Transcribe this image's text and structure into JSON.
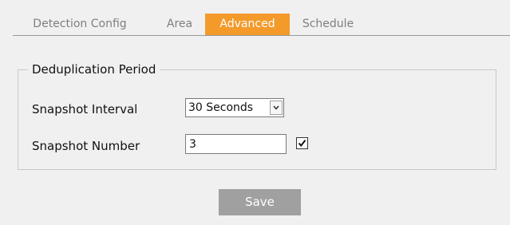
{
  "tabs": [
    {
      "label": "Detection Config",
      "active": false
    },
    {
      "label": "Area",
      "active": false
    },
    {
      "label": "Advanced",
      "active": true
    },
    {
      "label": "Schedule",
      "active": false
    }
  ],
  "section": {
    "title": "Deduplication Period"
  },
  "snapshot_interval": {
    "label": "Snapshot Interval",
    "selected_value": "30 Seconds",
    "icon": "chevron-down-icon"
  },
  "snapshot_number": {
    "label": "Snapshot Number",
    "value": "3",
    "checkbox_checked": true,
    "icon": "checkmark-icon"
  },
  "save_label": "Save",
  "colors": {
    "accent": "#f39a2a",
    "background": "#f0f0f0",
    "button": "#a0a0a0",
    "tab_inactive_text": "#7f7f7f"
  }
}
